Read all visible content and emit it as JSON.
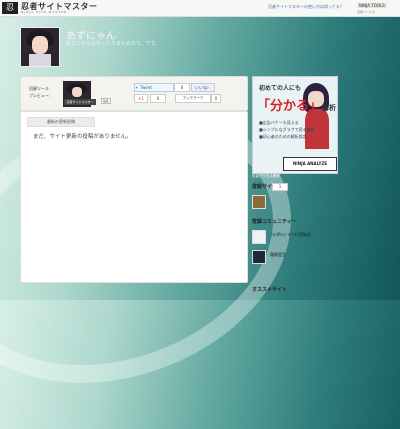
{
  "topbar": {
    "logo_glyph": "忍",
    "logo_text": "忍者サイトマスター",
    "logo_sub": "NINJA SITE MASTER",
    "promo_link": "忍者サイトマスターの使い方は知ってる？",
    "brand": "NINJA TOOLS",
    "brand_sub": "忍者ツールズ"
  },
  "profile": {
    "name": "あずにゃん",
    "description": "あずにゃんの作ったりまとめたり、です。"
  },
  "preview": {
    "label": "回廊ツール\nプレビュー：",
    "badge_label": "忍者サイトマスター",
    "edit_label": "編集"
  },
  "social": {
    "tweet_label": "Tweet",
    "tweet_count": "0",
    "like_label": "いいね！",
    "plus_label": "+1",
    "plus_count": "0",
    "bookmark_label": "ブックマーク",
    "bookmark_count": "0"
  },
  "main": {
    "tab_label": "最新の更新投稿",
    "empty_message": "まだ、サイト更新の投稿がありません。"
  },
  "banner": {
    "headline": "初めての人にも",
    "big_text": "「分かる」",
    "big_suffix": "解析",
    "list": [
      "■広告バナーも見える",
      "■シンプルなグラフで見る解析",
      "■初心者のための解析設定"
    ],
    "ribbon": "NINJA ANALYZE",
    "caption": "忍者アクセス解析"
  },
  "sidebar": {
    "sites_title": "登録サイト一覧",
    "sites_count": "1",
    "community_title": "登録コミュニティー",
    "communities": [
      {
        "name": "コロPuトマン仔貴報局"
      },
      {
        "name": "羅最歴型"
      }
    ],
    "recommend_title": "オススメサイト"
  },
  "colors": {
    "accent": "#2a6aa7",
    "banner_red": "#d22222"
  }
}
